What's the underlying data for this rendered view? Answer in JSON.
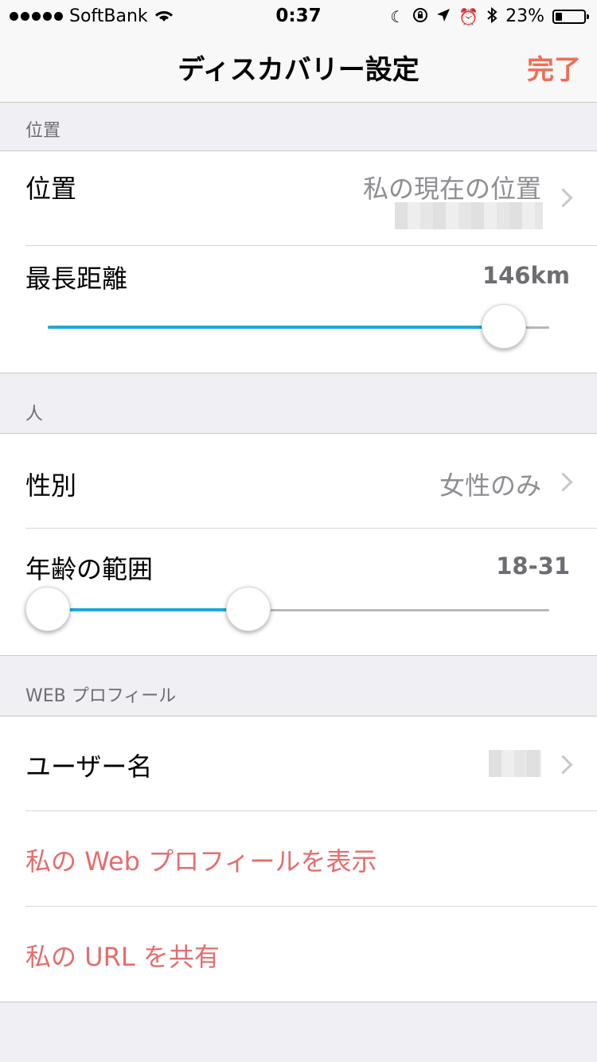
{
  "status_bar": {
    "carrier": "SoftBank",
    "time": "0:37",
    "battery": "23%",
    "battery_level": 0.23,
    "icons": [
      "wifi-icon",
      "moon-icon",
      "rotation-lock-icon",
      "location-arrow-icon",
      "alarm-icon",
      "bluetooth-icon",
      "battery-icon"
    ]
  },
  "nav": {
    "title": "ディスカバリー設定",
    "done_label": "完了",
    "done_color": "#f26b55"
  },
  "sections": {
    "location": {
      "header": "位置",
      "location_row": {
        "label": "位置",
        "value": "私の現在の位置"
      },
      "distance_row": {
        "label": "最長距離",
        "value": "146km",
        "slider_value_fraction": 0.91
      }
    },
    "people": {
      "header": "人",
      "gender_row": {
        "label": "性別",
        "value": "女性のみ"
      },
      "age_row": {
        "label": "年齢の範囲",
        "value": "18-31",
        "range_min_fraction": 0.0,
        "range_max_fraction": 0.4
      }
    },
    "web_profile": {
      "header": "WEB プロフィール",
      "username_row": {
        "label": "ユーザー名"
      },
      "view_profile_link": "私の Web プロフィールを表示",
      "share_url_link": "私の URL を共有"
    }
  },
  "colors": {
    "accent": "#f26b55",
    "link": "#e76c6c",
    "slider": "#1fa8d8"
  }
}
